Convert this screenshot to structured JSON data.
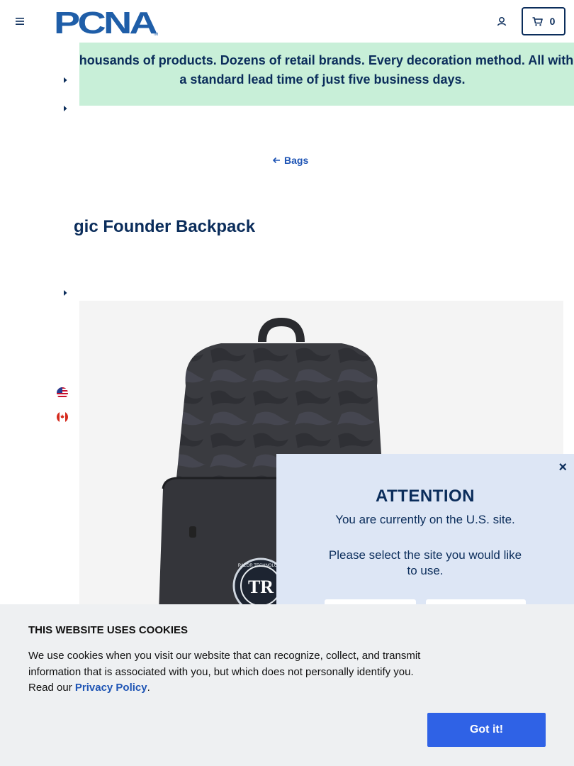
{
  "header": {
    "logo_text": "PCNA",
    "logo_tm": "TM",
    "cart_count": "0"
  },
  "promo": {
    "text": "Thousands of products. Dozens of retail brands. Every decoration method. All with a standard lead time of just five business days."
  },
  "breadcrumb": {
    "back_label": "Bags"
  },
  "product": {
    "title": "gic Founder Backpack",
    "patch_text": "RAZOR TECHNOLOGY",
    "patch_letters": "TR"
  },
  "modal": {
    "close_label": "×",
    "title": "ATTENTION",
    "message": "You are currently on the U.S. site.",
    "message2": "Please select the site you would like to use."
  },
  "cookie": {
    "title": "THIS WEBSITE USES COOKIES",
    "body_before": "We use cookies when you visit our website that can recognize, collect, and transmit information that is associated with you, but which does not personally identify you. Read our ",
    "link_label": "Privacy Policy",
    "body_after": ".",
    "button_label": "Got it!"
  },
  "colors": {
    "navy": "#0b2d5b",
    "promo_bg": "#c8efd8",
    "modal_bg": "#dde6f5",
    "cookie_bg": "#eef0f2",
    "accent_button": "#2f62e6",
    "link": "#1f55b5"
  },
  "icons": [
    "hamburger-menu-icon",
    "account-icon",
    "cart-icon",
    "arrow-left-icon",
    "caret-right-icon",
    "us-flag-icon",
    "canada-flag-icon",
    "close-icon"
  ]
}
